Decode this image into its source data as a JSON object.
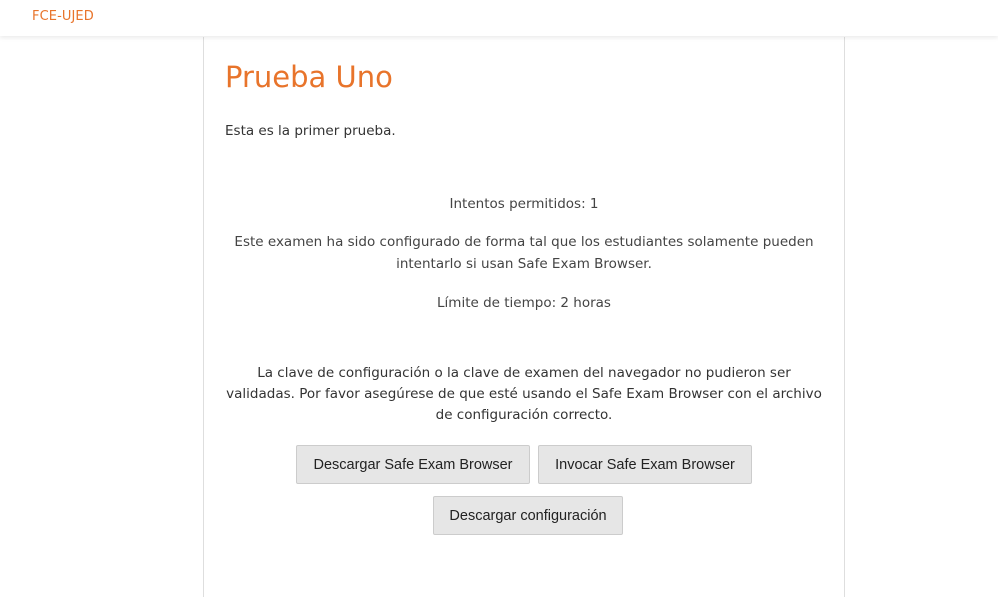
{
  "navbar": {
    "brand": "FCE-UJED"
  },
  "quiz": {
    "title": "Prueba Uno",
    "intro": "Esta es la primer prueba.",
    "attempts_allowed": "Intentos permitidos: 1",
    "seb_required": "Este examen ha sido configurado de forma tal que los estudiantes solamente pueden intentarlo si usan Safe Exam Browser.",
    "time_limit": "Límite de tiempo: 2 horas",
    "validation_error": "La clave de configuración o la clave de examen del navegador no pudieron ser validadas. Por favor asegúrese de que esté usando el Safe Exam Browser con el archivo de configuración correcto."
  },
  "buttons": {
    "download_seb": "Descargar Safe Exam Browser",
    "launch_seb": "Invocar Safe Exam Browser",
    "download_config": "Descargar configuración"
  },
  "colors": {
    "accent": "#e8742b",
    "button_bg": "#e6e6e6"
  }
}
